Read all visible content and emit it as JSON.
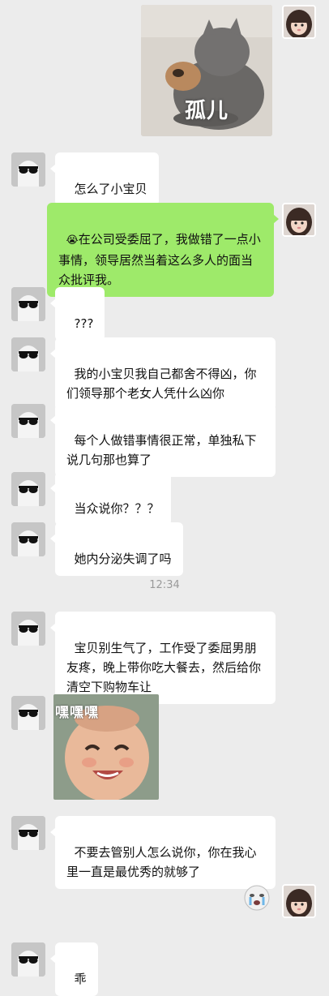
{
  "conversation": {
    "messages": [
      {
        "side": "right",
        "type": "sticker",
        "caption": "孤儿"
      },
      {
        "side": "left",
        "type": "text",
        "text": "怎么了小宝贝"
      },
      {
        "side": "right",
        "type": "text",
        "emoji": "😭",
        "text": "在公司受委屈了，我做错了一点小事情，领导居然当着这么多人的面当众批评我。"
      },
      {
        "side": "left",
        "type": "text",
        "text": "???"
      },
      {
        "side": "left",
        "type": "text",
        "text": "我的小宝贝我自己都舍不得凶，你们领导那个老女人凭什么凶你"
      },
      {
        "side": "left",
        "type": "text",
        "text": "每个人做错事情很正常，单独私下说几句那也算了"
      },
      {
        "side": "left",
        "type": "text",
        "text": "当众说你？？？"
      },
      {
        "side": "left",
        "type": "text",
        "text": "她内分泌失调了吗"
      },
      {
        "type": "timestamp",
        "text": "12:34"
      },
      {
        "side": "left",
        "type": "text",
        "text": "宝贝别生气了，工作受了委屈男朋友疼，晚上带你吃大餐去，然后给你清空下购物车让"
      },
      {
        "side": "left",
        "type": "sticker",
        "caption": "嘿嘿嘿"
      },
      {
        "side": "left",
        "type": "text",
        "text": "不要去管别人怎么说你，你在我心里一直是最优秀的就够了"
      },
      {
        "side": "right",
        "type": "small-sticker"
      },
      {
        "side": "left",
        "type": "text",
        "text": "乖"
      }
    ]
  },
  "colors": {
    "background": "#ececec",
    "bubble_left": "#ffffff",
    "bubble_right": "#9eea6a",
    "timestamp": "#9a9a9a"
  },
  "icons": {
    "left_avatar": "ghost-sunglasses-avatar",
    "right_avatar": "girl-avatar"
  }
}
